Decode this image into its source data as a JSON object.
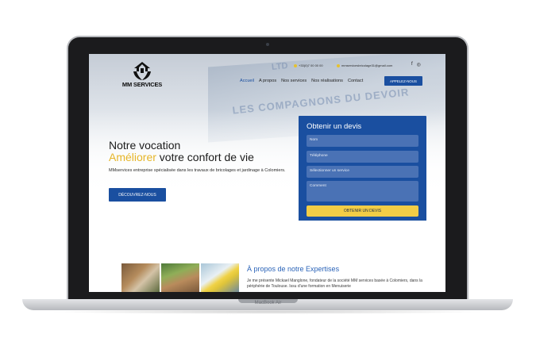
{
  "device": {
    "label": "MacBook Air"
  },
  "logo": {
    "text": "MM SERVICES"
  },
  "topbar": {
    "phone": "+33(0)7 00 00 00",
    "email": "mmservicesbricolage31@gmail.com",
    "social": [
      "facebook-icon",
      "instagram-icon"
    ]
  },
  "nav": {
    "items": [
      "Accueil",
      "A propos",
      "Nos services",
      "Nos réalisations",
      "Contact"
    ],
    "cta": "APPELEZ-NOUS"
  },
  "hero": {
    "line1": "Notre vocation",
    "accent": "Améliorer",
    "line2_rest": " votre confort de vie",
    "description": "MMservices entreprise spécialisée dans les travaux de bricolages et jardinage à Colomiers.",
    "button": "DÉCOUVREZ-NOUS"
  },
  "quote_form": {
    "title": "Obtenir un devis",
    "fields": [
      "Nom",
      "Téléphone",
      "Sélectionner un service",
      "Comment"
    ],
    "submit": "OBTENIR UN DEVIS"
  },
  "about": {
    "title": "À propos de notre Expertises",
    "text": "Je me présente Mickael Manglone, fondateur de la société MM services basée à Colomiers, dans la périphérie de Toulouse. Issu d'une formation en Menuiserie"
  },
  "colors": {
    "primary": "#1a4fa0",
    "accent": "#e6b528",
    "button_yellow": "#f2cd46"
  }
}
